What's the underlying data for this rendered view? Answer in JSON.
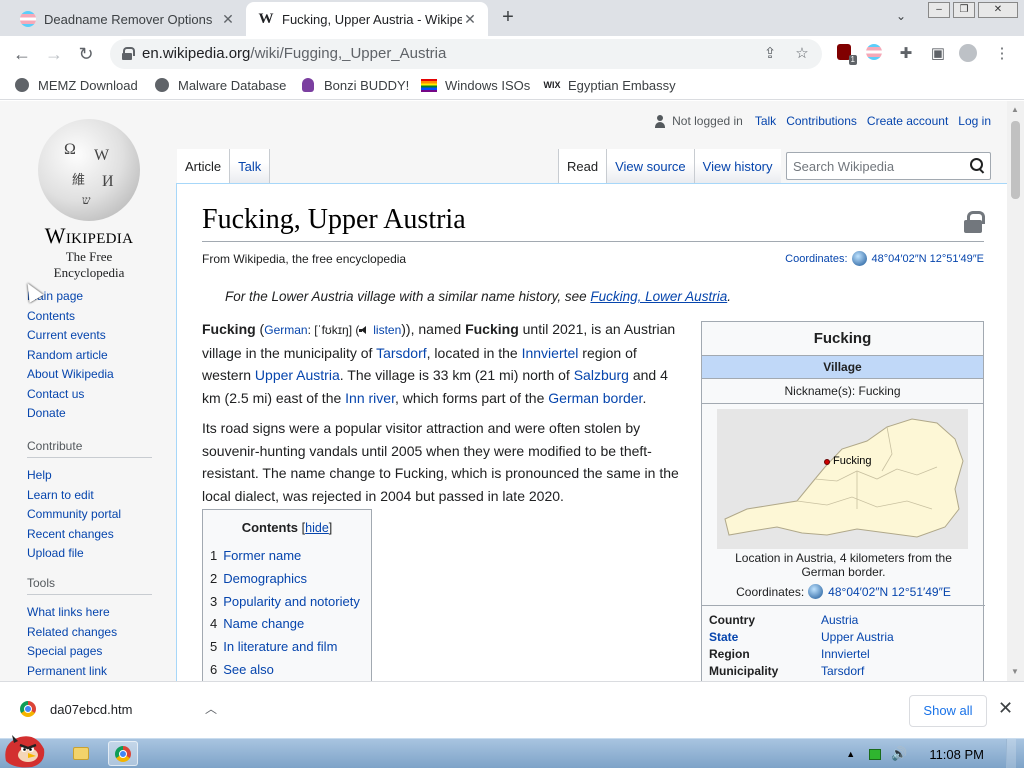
{
  "browser": {
    "tabs": [
      {
        "title": "Deadname Remover Options",
        "active": false,
        "icon": "trans-flag-icon"
      },
      {
        "title": "Fucking, Upper Austria - Wikipedia",
        "active": true,
        "icon": "wikipedia-w-icon"
      }
    ],
    "url_domain": "en.wikipedia.org",
    "url_path": "/wiki/Fugging,_Upper_Austria",
    "extension_badge": "1",
    "bookmarks": [
      {
        "label": "MEMZ Download",
        "icon": "globe-icon"
      },
      {
        "label": "Malware Database",
        "icon": "globe-icon"
      },
      {
        "label": "Bonzi BUDDY!",
        "icon": "bonzi-icon"
      },
      {
        "label": "Windows ISOs",
        "icon": "rainbow-flag-icon"
      },
      {
        "label": "Egyptian Embassy",
        "icon": "wix-icon"
      }
    ]
  },
  "wiki": {
    "logo_word": "Wikipedia",
    "logo_tagline": "The Free Encyclopedia",
    "nav_main": [
      "Main page",
      "Contents",
      "Current events",
      "Random article",
      "About Wikipedia",
      "Contact us",
      "Donate"
    ],
    "contribute_head": "Contribute",
    "nav_contribute": [
      "Help",
      "Learn to edit",
      "Community portal",
      "Recent changes",
      "Upload file"
    ],
    "tools_head": "Tools",
    "nav_tools": [
      "What links here",
      "Related changes",
      "Special pages",
      "Permanent link"
    ],
    "personal": {
      "not_logged_in": "Not logged in",
      "links": [
        "Talk",
        "Contributions",
        "Create account",
        "Log in"
      ]
    },
    "tabs_left": [
      "Article",
      "Talk"
    ],
    "tabs_right": [
      "Read",
      "View source",
      "View history"
    ],
    "search_placeholder": "Search Wikipedia",
    "title": "Fucking, Upper Austria",
    "site_sub": "From Wikipedia, the free encyclopedia",
    "coords_label": "Coordinates:",
    "coords_value": "48°04′02″N 12°51′49″E",
    "hatnote_prefix": "For the Lower Austria village with a similar name history, see ",
    "hatnote_link": "Fucking, Lower Austria",
    "hatnote_suffix": ".",
    "p1": {
      "b1": "Fucking",
      "t1": " (",
      "german": "German",
      "t2": ": [ˈfʊkɪŋ] (",
      "listen": "listen",
      "t3": ")), named ",
      "b2": "Fucking",
      "t4": " until 2021, is an Austrian village in the municipality of ",
      "l1": "Tarsdorf",
      "t5": ", located in the ",
      "l2": "Innviertel",
      "t6": " region of western ",
      "l3": "Upper Austria",
      "t7": ". The village is 33 km (21 mi) north of ",
      "l4": "Salzburg",
      "t8": " and 4 km (2.5 mi) east of the ",
      "l5": "Inn river",
      "t9": ", which forms part of the ",
      "l6": "German border",
      "t10": "."
    },
    "p2": "Its road signs were a popular visitor attraction and were often stolen by souvenir-hunting vandals until 2005 when they were modified to be theft-resistant. The name change to Fucking, which is pronounced the same in the local dialect, was rejected in 2004 but passed in late 2020.",
    "toc": {
      "title": "Contents",
      "hide": "hide",
      "items": [
        {
          "num": "1",
          "label": "Former name"
        },
        {
          "num": "2",
          "label": "Demographics"
        },
        {
          "num": "3",
          "label": "Popularity and notoriety"
        },
        {
          "num": "4",
          "label": "Name change"
        },
        {
          "num": "5",
          "label": "In literature and film"
        },
        {
          "num": "6",
          "label": "See also"
        }
      ]
    },
    "infobox": {
      "title": "Fucking",
      "subtitle": "Village",
      "nickname": "Nickname(s): Fucking",
      "map_label": "Fucking",
      "caption": "Location in Austria, 4 kilometers from the German border.",
      "coords_label": "Coordinates:",
      "coords_value": "48°04′02″N 12°51′49″E",
      "rows": [
        {
          "k": "Country",
          "v": "Austria",
          "k_link": false
        },
        {
          "k": "State",
          "v": "Upper Austria",
          "k_link": true
        },
        {
          "k": "Region",
          "v": "Innviertel",
          "k_link": false
        },
        {
          "k": "Municipality",
          "v": "Tarsdorf",
          "k_link": false
        }
      ]
    }
  },
  "download": {
    "file": "da07ebcd.htm",
    "show_all": "Show all"
  },
  "taskbar": {
    "time": "11:08 PM"
  }
}
